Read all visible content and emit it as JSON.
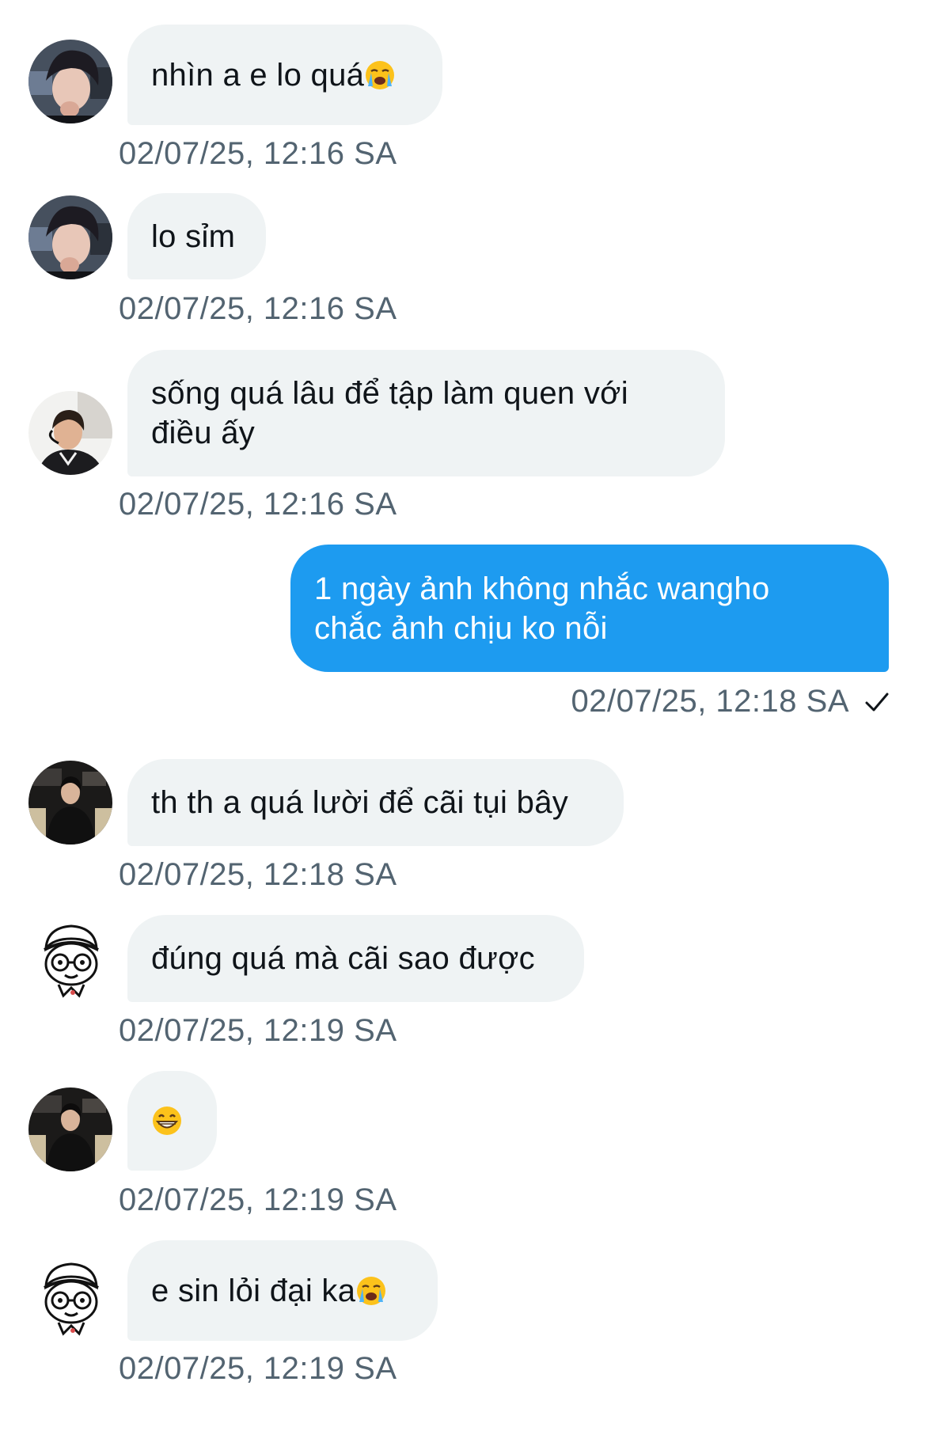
{
  "messages": [
    {
      "sender": "avatar-blonde",
      "text": "nhìn a e lo quá",
      "emoji": "crying-face",
      "time": "02/07/25, 12:16 SA"
    },
    {
      "sender": "avatar-blonde",
      "text": "lo sỉm",
      "time": "02/07/25, 12:16 SA"
    },
    {
      "sender": "avatar-headset",
      "text": "sống quá lâu để tập làm quen với\nđiều ấy",
      "time": "02/07/25, 12:16 SA"
    },
    {
      "sender": "me",
      "text": "1 ngày ảnh không nhắc wangho\nchắc ảnh chịu ko nỗi",
      "time": "02/07/25, 12:18 SA",
      "status_icon": "check-icon"
    },
    {
      "sender": "avatar-dark-jacket",
      "text": "th th a quá lười để cãi tụi bây",
      "time": "02/07/25, 12:18 SA"
    },
    {
      "sender": "avatar-cartoon",
      "text": "đúng quá mà cãi sao được",
      "time": "02/07/25, 12:19 SA"
    },
    {
      "sender": "avatar-dark-jacket",
      "text": "",
      "emoji": "grinning-face",
      "time": "02/07/25, 12:19 SA"
    },
    {
      "sender": "avatar-cartoon",
      "text": "e sin lỏi đại ka",
      "emoji": "crying-face",
      "time": "02/07/25, 12:19 SA"
    }
  ],
  "colors": {
    "incoming_bubble": "#eff3f4",
    "outgoing_bubble": "#1d9bf0",
    "timestamp": "#536471"
  }
}
